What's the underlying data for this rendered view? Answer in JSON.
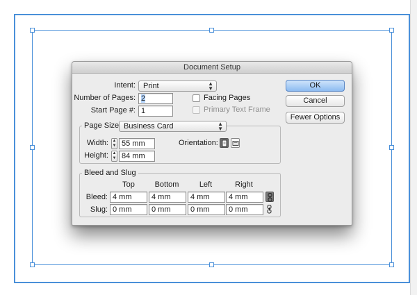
{
  "dialog": {
    "title": "Document Setup",
    "intent_label": "Intent:",
    "intent_value": "Print",
    "pages_label": "Number of Pages:",
    "pages_value": "2",
    "start_label": "Start Page #:",
    "start_value": "1",
    "facing_label": "Facing Pages",
    "facing_checked": false,
    "primary_frame_label": "Primary Text Frame",
    "primary_frame_checked": false,
    "buttons": {
      "ok": "OK",
      "cancel": "Cancel",
      "fewer": "Fewer Options"
    },
    "page_size": {
      "label": "Page Size:",
      "value": "Business Card",
      "width_label": "Width:",
      "width_value": "55 mm",
      "height_label": "Height:",
      "height_value": "84 mm",
      "orientation_label": "Orientation:",
      "orientation_selected": "portrait"
    },
    "bleed_slug": {
      "title": "Bleed and Slug",
      "columns": [
        "Top",
        "Bottom",
        "Left",
        "Right"
      ],
      "bleed_label": "Bleed:",
      "bleed": [
        "4 mm",
        "4 mm",
        "4 mm",
        "4 mm"
      ],
      "slug_label": "Slug:",
      "slug": [
        "0 mm",
        "0 mm",
        "0 mm",
        "0 mm"
      ],
      "bleed_linked": true,
      "slug_linked": false
    }
  },
  "colors": {
    "frame": "#4a90d9",
    "ok_button": "#8dbbf1",
    "dialog_bg": "#ececec"
  }
}
